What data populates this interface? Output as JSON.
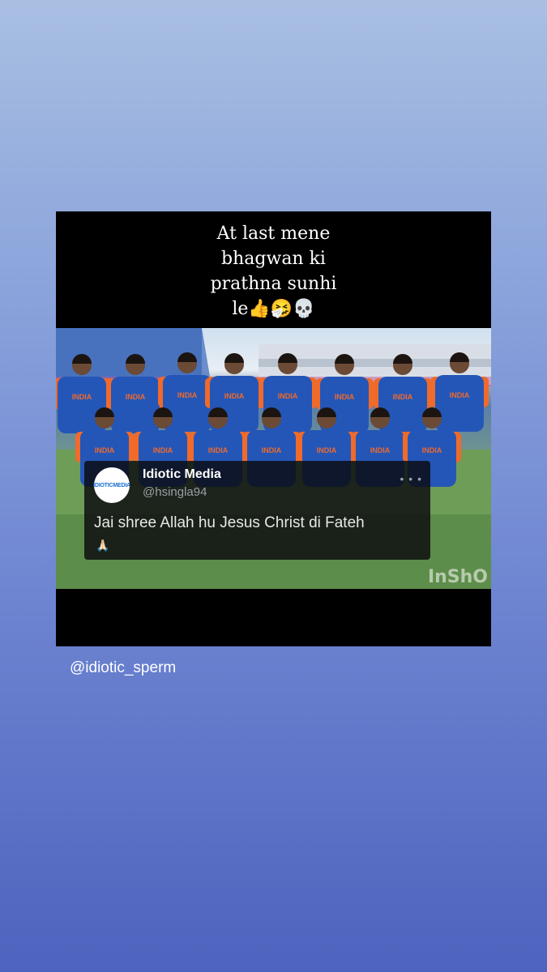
{
  "story": {
    "caption_lines": [
      "At last mene",
      "bhagwan ki",
      "prathna sunhi",
      "le👍🤧💀"
    ],
    "username": "@idiotic_sperm"
  },
  "tweet": {
    "avatar_text": "IDIOTICMEDIA",
    "name": "Idiotic Media",
    "handle": "@hsingla94",
    "more_icon": "ellipsis-icon",
    "text": "Jai shree Allah hu Jesus Christ di Fateh",
    "emoji": "🙏🏻"
  },
  "photo": {
    "jersey_text": "INDIA",
    "watermark": "InShO"
  },
  "colors": {
    "jersey_blue": "#2456b8",
    "jersey_orange": "#f06a2a",
    "card_bg": "#000000"
  }
}
